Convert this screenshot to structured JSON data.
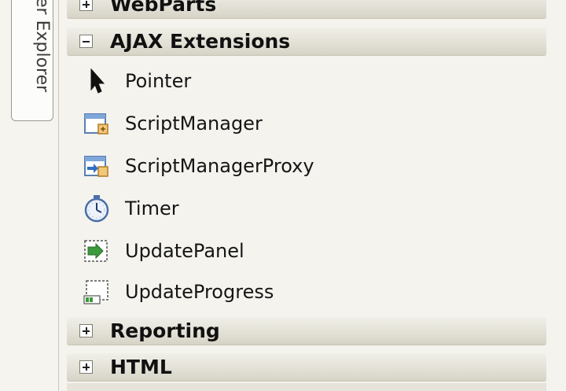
{
  "side_tab": {
    "label": "er Explorer"
  },
  "groups": {
    "webparts": {
      "title": "WebParts",
      "state": "collapsed"
    },
    "ajax": {
      "title": "AJAX Extensions",
      "state": "expanded"
    },
    "reporting": {
      "title": "Reporting",
      "state": "collapsed"
    },
    "html": {
      "title": "HTML",
      "state": "collapsed"
    }
  },
  "ajax_items": [
    {
      "label": "Pointer",
      "icon": "pointer-icon"
    },
    {
      "label": "ScriptManager",
      "icon": "script-manager-icon"
    },
    {
      "label": "ScriptManagerProxy",
      "icon": "script-manager-proxy-icon"
    },
    {
      "label": "Timer",
      "icon": "timer-icon"
    },
    {
      "label": "UpdatePanel",
      "icon": "update-panel-icon"
    },
    {
      "label": "UpdateProgress",
      "icon": "update-progress-icon"
    }
  ]
}
